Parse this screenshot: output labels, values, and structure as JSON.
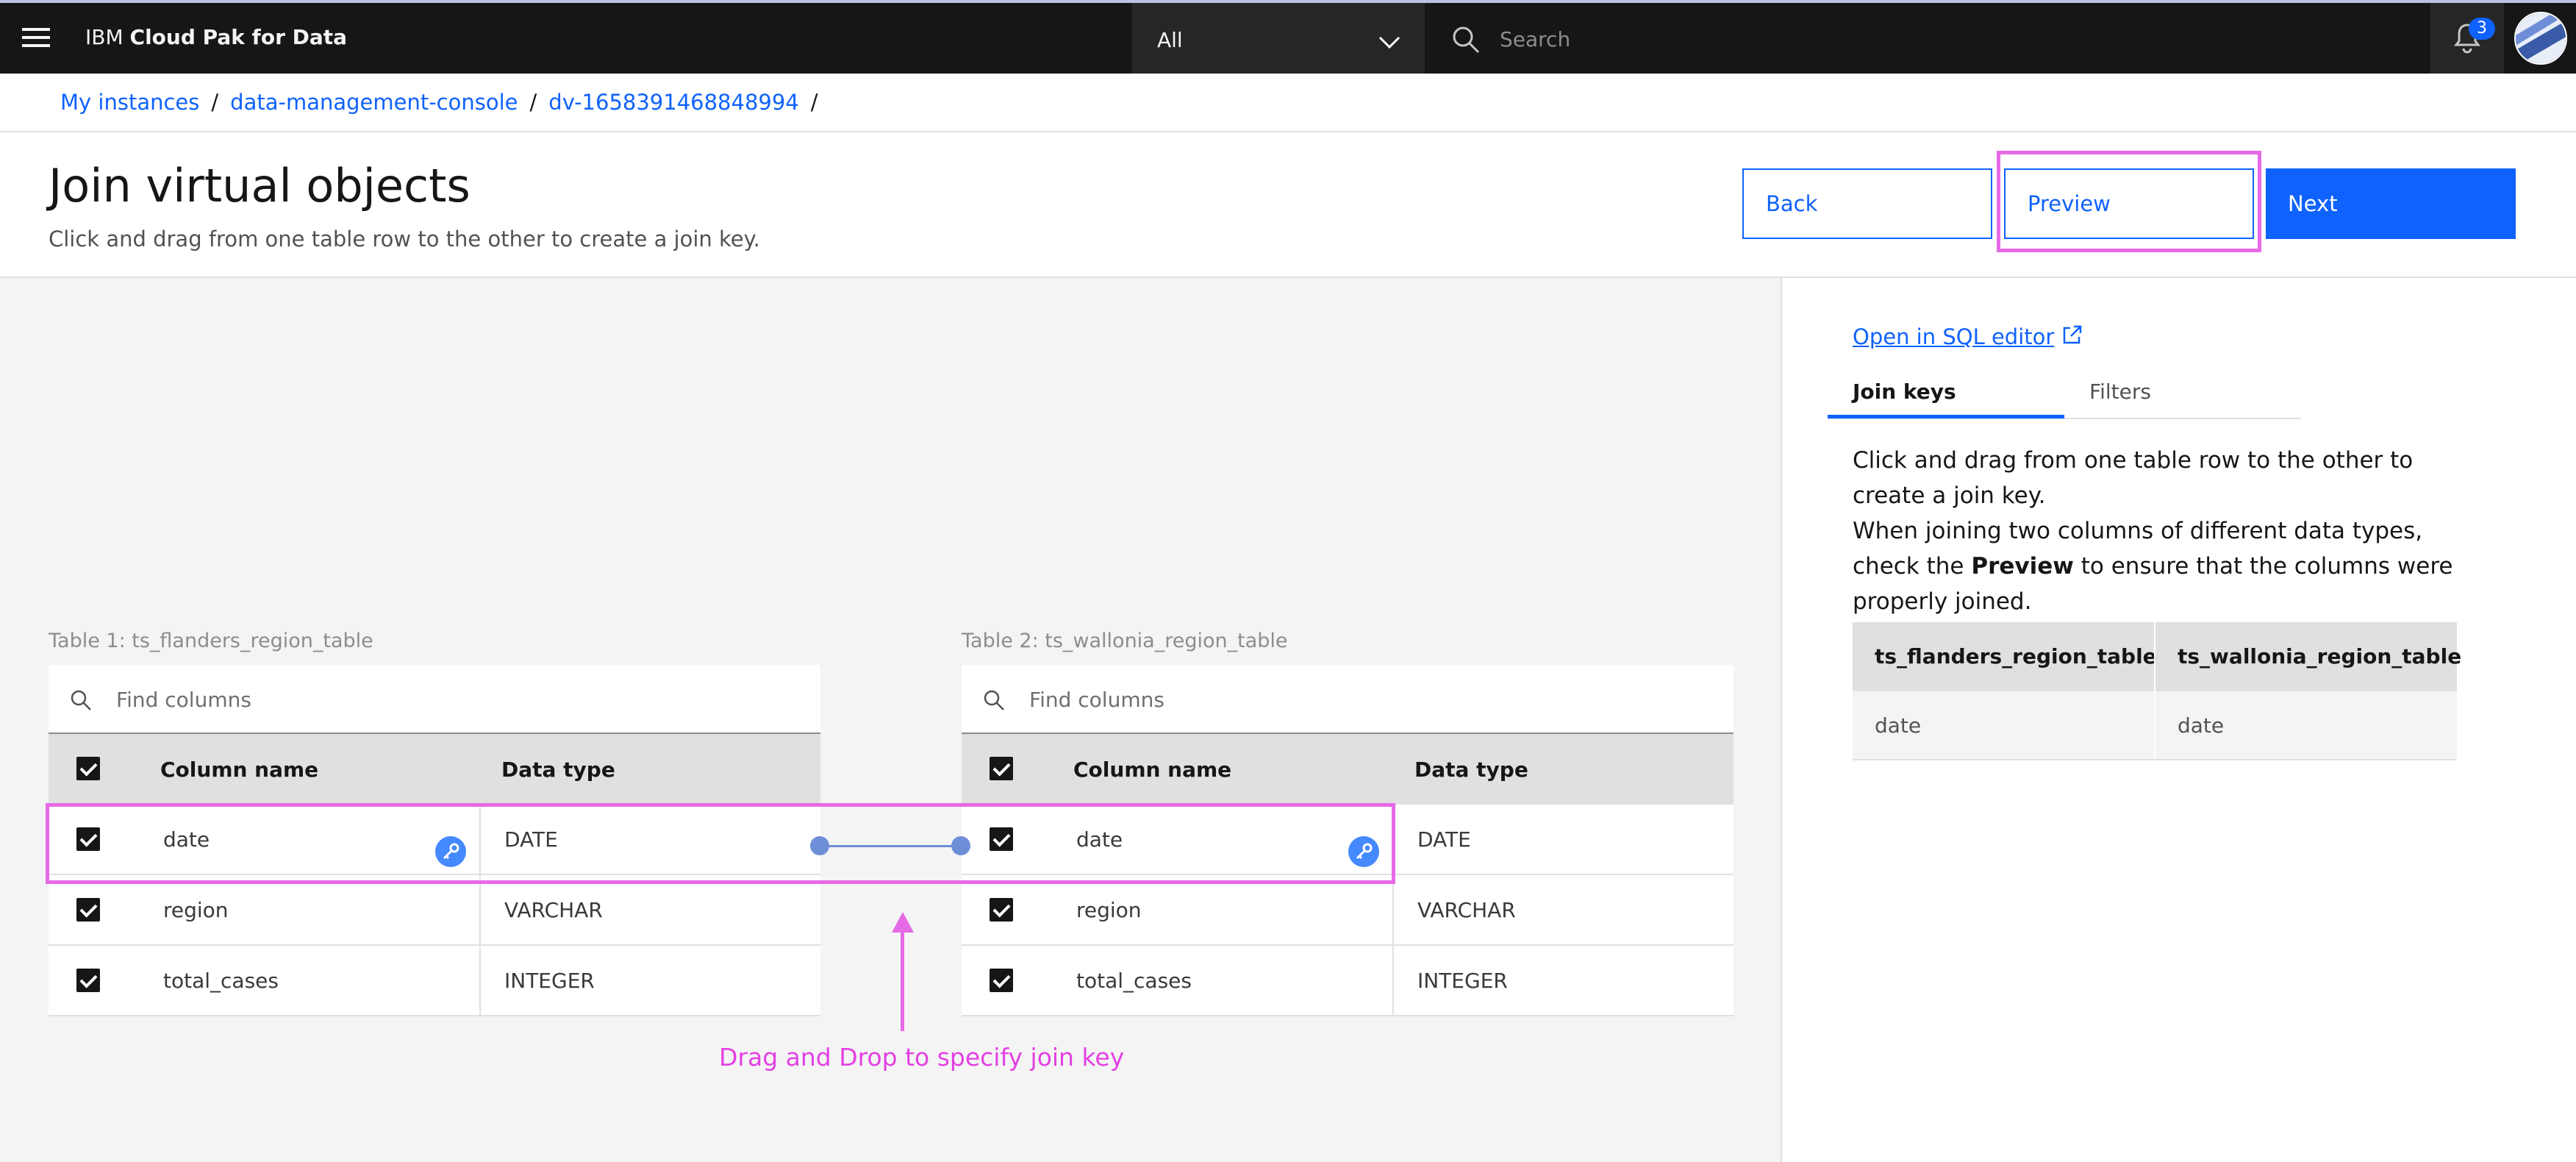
{
  "header": {
    "brand_prefix": "IBM",
    "brand_name": "Cloud Pak for Data",
    "scope_value": "All",
    "search_placeholder": "Search",
    "notification_count": "3"
  },
  "breadcrumb": [
    "My instances",
    "data-management-console",
    "dv-1658391468848994"
  ],
  "page": {
    "title": "Join virtual objects",
    "subtitle": "Click and drag from one table row to the other to create a join key.",
    "back_label": "Back",
    "preview_label": "Preview",
    "next_label": "Next"
  },
  "table1": {
    "title": "Table 1: ts_flanders_region_table",
    "search_placeholder": "Find columns",
    "col_name_header": "Column name",
    "col_type_header": "Data type",
    "rows": [
      {
        "name": "date",
        "type": "DATE",
        "checked": true
      },
      {
        "name": "region",
        "type": "VARCHAR",
        "checked": true
      },
      {
        "name": "total_cases",
        "type": "INTEGER",
        "checked": true
      }
    ]
  },
  "table2": {
    "title": "Table 2: ts_wallonia_region_table",
    "search_placeholder": "Find columns",
    "col_name_header": "Column name",
    "col_type_header": "Data type",
    "rows": [
      {
        "name": "date",
        "type": "DATE",
        "checked": true
      },
      {
        "name": "region",
        "type": "VARCHAR",
        "checked": true
      },
      {
        "name": "total_cases",
        "type": "INTEGER",
        "checked": true
      }
    ]
  },
  "annotation": {
    "label": "Drag and Drop to specify join key",
    "color": "#e66ae6"
  },
  "right_panel": {
    "sql_link": "Open in SQL editor",
    "tabs": [
      "Join keys",
      "Filters"
    ],
    "info_line1": "Click and drag from one table row to the other to create a join key.",
    "info_line2_prefix": "When joining two columns of different data types, check the",
    "info_line2_bold": "Preview",
    "info_line2_suffix": "to ensure that the columns were properly joined.",
    "join_table": {
      "headers": [
        "ts_flanders_region_table",
        "ts_wallonia_region_table"
      ],
      "rows": [
        [
          "date",
          "date"
        ]
      ]
    }
  },
  "colors": {
    "accent": "#0f62fe",
    "header_bg": "#161616",
    "key_icon": "#4589ff",
    "join_line": "#6f8ed8"
  }
}
